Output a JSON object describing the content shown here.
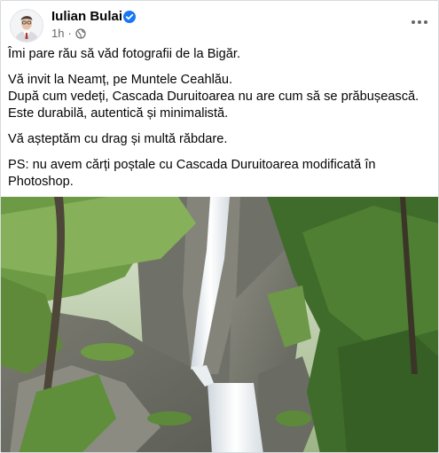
{
  "post": {
    "author": "Iulian Bulai",
    "verified_icon": "verified-badge-icon",
    "time": "1h",
    "privacy_icon": "globe-icon",
    "more_icon": "more-options-icon",
    "paragraphs": [
      [
        "Îmi pare rău să văd fotografii de la Bigăr."
      ],
      [
        "Vă invit la Neamț, pe Muntele Ceahlău.",
        "După cum vedeți, Cascada Duruitoarea nu are cum să se prăbușească.",
        "Este durabilă, autentică și minimalistă."
      ],
      [
        "Vă așteptăm cu drag și multă răbdare."
      ],
      [
        "PS: nu avem cărți poștale cu Cascada Duruitoarea modificată în",
        "Photoshop."
      ]
    ]
  },
  "colors": {
    "name": "#050505",
    "meta": "#65676b",
    "badge": "#1877f2"
  }
}
